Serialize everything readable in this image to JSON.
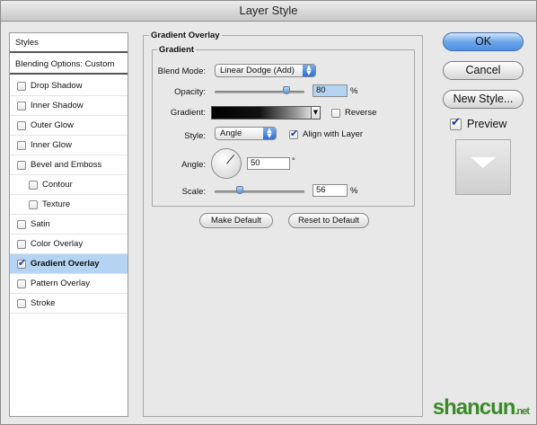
{
  "window": {
    "title": "Layer Style"
  },
  "left_panel": {
    "header": "Styles",
    "blending": "Blending Options: Custom",
    "items": [
      {
        "label": "Drop Shadow",
        "checked": false,
        "selected": false,
        "indent": false
      },
      {
        "label": "Inner Shadow",
        "checked": false,
        "selected": false,
        "indent": false
      },
      {
        "label": "Outer Glow",
        "checked": false,
        "selected": false,
        "indent": false
      },
      {
        "label": "Inner Glow",
        "checked": false,
        "selected": false,
        "indent": false
      },
      {
        "label": "Bevel and Emboss",
        "checked": false,
        "selected": false,
        "indent": false
      },
      {
        "label": "Contour",
        "checked": false,
        "selected": false,
        "indent": true
      },
      {
        "label": "Texture",
        "checked": false,
        "selected": false,
        "indent": true
      },
      {
        "label": "Satin",
        "checked": false,
        "selected": false,
        "indent": false
      },
      {
        "label": "Color Overlay",
        "checked": false,
        "selected": false,
        "indent": false
      },
      {
        "label": "Gradient Overlay",
        "checked": true,
        "selected": true,
        "indent": false
      },
      {
        "label": "Pattern Overlay",
        "checked": false,
        "selected": false,
        "indent": false
      },
      {
        "label": "Stroke",
        "checked": false,
        "selected": false,
        "indent": false
      }
    ]
  },
  "panel": {
    "title": "Gradient Overlay",
    "group_title": "Gradient",
    "blend_mode_label": "Blend Mode:",
    "blend_mode_value": "Linear Dodge (Add)",
    "opacity_label": "Opacity:",
    "opacity_value": "80",
    "opacity_unit": "%",
    "gradient_label": "Gradient:",
    "reverse_label": "Reverse",
    "reverse_checked": false,
    "style_label": "Style:",
    "style_value": "Angle",
    "align_label": "Align with Layer",
    "align_checked": true,
    "angle_label": "Angle:",
    "angle_value": "50",
    "angle_unit": "°",
    "scale_label": "Scale:",
    "scale_value": "56",
    "scale_unit": "%",
    "make_default": "Make Default",
    "reset_default": "Reset to Default"
  },
  "sliders": {
    "opacity_fraction": 0.8,
    "scale_fraction": 0.28
  },
  "buttons": {
    "ok": "OK",
    "cancel": "Cancel",
    "new_style": "New Style..."
  },
  "preview": {
    "label": "Preview",
    "checked": true
  },
  "watermark": {
    "main": "shancun",
    "sub": ".net"
  },
  "colors": {
    "selection": "#b5d3f3",
    "accent_blue": "#4c8fe3",
    "watermark_green": "#3b8a2a"
  }
}
